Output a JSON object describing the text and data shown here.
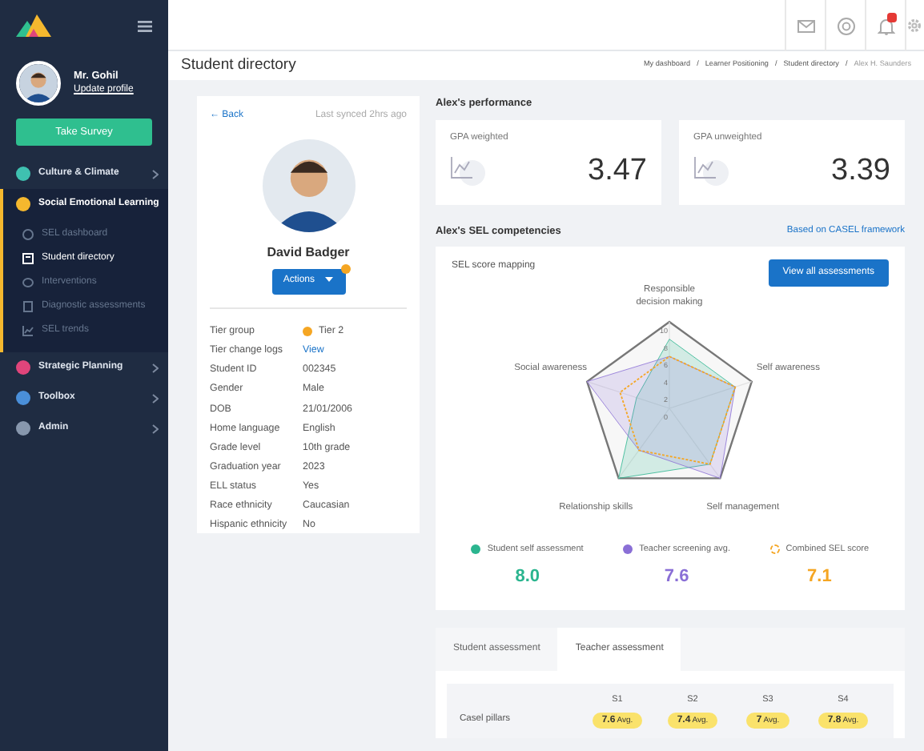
{
  "sidebar": {
    "profile": {
      "name": "Mr. Gohil",
      "link": "Update profile"
    },
    "survey_button": "Take Survey",
    "items": [
      {
        "label": "Culture & Climate",
        "color": "#3fc1b0",
        "expanded": false,
        "selected": false
      },
      {
        "label": "Social Emotional Learning",
        "color": "#f5b82e",
        "expanded": true,
        "selected": true,
        "children": [
          {
            "label": "SEL dashboard",
            "selected": false
          },
          {
            "label": "Student directory",
            "selected": true
          },
          {
            "label": "Interventions",
            "selected": false
          },
          {
            "label": "Diagnostic assessments",
            "selected": false
          },
          {
            "label": "SEL trends",
            "selected": false
          }
        ]
      },
      {
        "label": "Strategic Planning",
        "color": "#e0457b",
        "expanded": false,
        "selected": false
      },
      {
        "label": "Toolbox",
        "color": "#4a8fd9",
        "expanded": false,
        "selected": false
      },
      {
        "label": "Admin",
        "color": "#8797ad",
        "expanded": false,
        "selected": false
      }
    ]
  },
  "topbar": {
    "notifications_unread": true
  },
  "page": {
    "title": "Student directory",
    "breadcrumb_separator": "/",
    "breadcrumb": [
      {
        "label": "My dashboard",
        "current": false
      },
      {
        "label": "Learner Positioning",
        "current": false
      },
      {
        "label": "Student directory",
        "current": false
      },
      {
        "label": "Alex H. Saunders",
        "current": true
      }
    ]
  },
  "student": {
    "back": "← Back",
    "synced": "Last synced 2hrs ago",
    "name": "David Badger",
    "actions": "Actions",
    "actions_alert": true,
    "details": [
      {
        "label": "Tier group",
        "value": "Tier 2",
        "kind": "tier",
        "color": "#f5a623"
      },
      {
        "label": "Tier change logs",
        "value": "View",
        "kind": "link"
      },
      {
        "label": "Student ID",
        "value": "002345",
        "kind": "text"
      },
      {
        "label": "Gender",
        "value": "Male",
        "kind": "text"
      },
      {
        "label": "DOB",
        "value": "21/01/2006",
        "kind": "text"
      },
      {
        "label": "Home language",
        "value": "English",
        "kind": "text"
      },
      {
        "label": "Grade level",
        "value": "10th grade",
        "kind": "text"
      },
      {
        "label": "Graduation year",
        "value": "2023",
        "kind": "text"
      },
      {
        "label": "ELL status",
        "value": "Yes",
        "kind": "text"
      },
      {
        "label": "Race ethnicity",
        "value": "Caucasian",
        "kind": "text"
      },
      {
        "label": "Hispanic ethnicity",
        "value": "No",
        "kind": "text"
      }
    ]
  },
  "performance": {
    "title": "Alex's performance",
    "gpa": [
      {
        "label": "GPA weighted",
        "value": "3.47"
      },
      {
        "label": "GPA unweighted",
        "value": "3.39"
      }
    ]
  },
  "sel": {
    "title": "Alex's SEL competencies",
    "link": "Based on CASEL framework",
    "card_title": "SEL score mapping",
    "button": "View all assessments",
    "chart_data": {
      "type": "radar",
      "categories": [
        "Responsible decision making",
        "Self awareness",
        "Self management",
        "Relationship skills",
        "Social awareness"
      ],
      "ylim": [
        0,
        10
      ],
      "yticks": [
        0,
        2,
        4,
        6,
        8,
        10
      ],
      "series": [
        {
          "name": "Student self assessment",
          "color": "#2bb58f",
          "values": [
            8,
            8,
            8,
            10,
            4
          ]
        },
        {
          "name": "Teacher screening avg.",
          "color": "#8a6fd6",
          "values": [
            6,
            8,
            10,
            6,
            10
          ]
        },
        {
          "name": "Combined SEL score",
          "color": "#f5a623",
          "values": [
            6,
            8,
            8,
            6,
            6
          ]
        }
      ]
    },
    "legend": [
      {
        "kind": "filled",
        "score": "8.0"
      },
      {
        "kind": "filled",
        "score": "7.6"
      },
      {
        "kind": "outline",
        "score": "7.1"
      }
    ]
  },
  "assessment": {
    "tabs": [
      {
        "label": "Student assessment",
        "selected": false
      },
      {
        "label": "Teacher assessment",
        "selected": true
      }
    ],
    "table": {
      "columns": [
        "S1",
        "S2",
        "S3",
        "S4"
      ],
      "rows": [
        {
          "label": "Casel pillars",
          "cells": [
            "**7.6** Avg.",
            "**7.4** Avg.",
            "**7** Avg.",
            "**7.8** Avg."
          ]
        }
      ]
    }
  }
}
